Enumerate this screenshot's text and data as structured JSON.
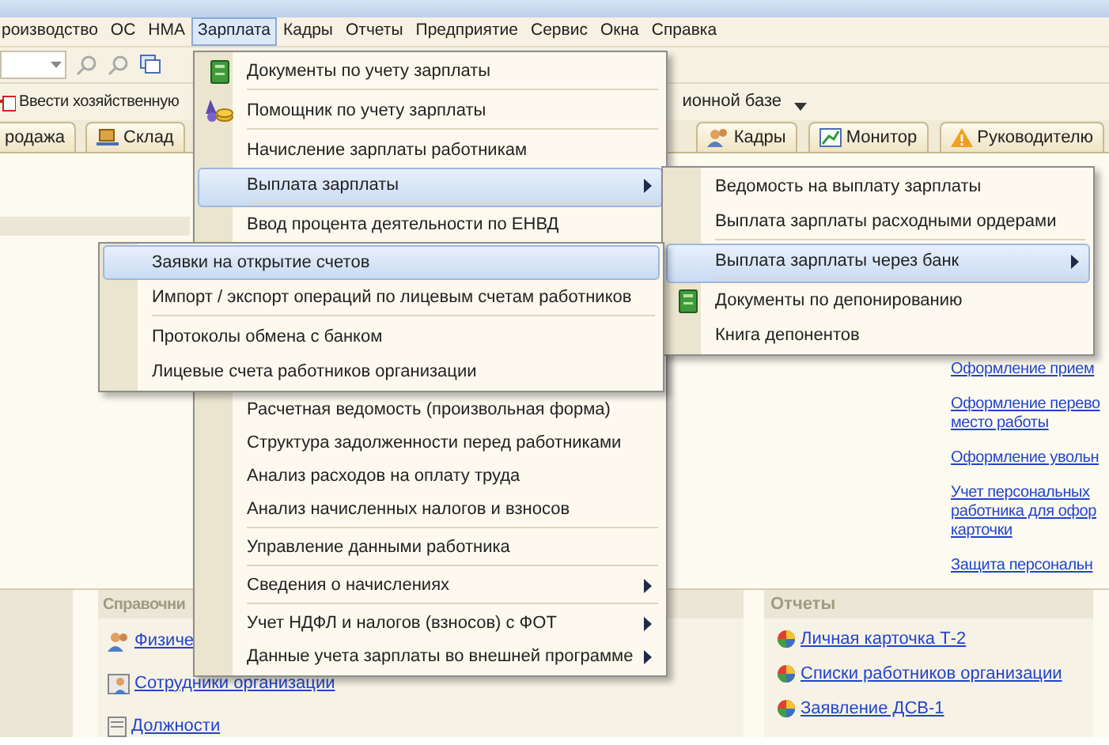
{
  "menubar": [
    {
      "label": "роизводство",
      "selected": false
    },
    {
      "label": "ОС",
      "selected": false
    },
    {
      "label": "НМА",
      "selected": false
    },
    {
      "label": "Зарплата",
      "selected": true
    },
    {
      "label": "Кадры",
      "selected": false
    },
    {
      "label": "Отчеты",
      "selected": false
    },
    {
      "label": "Предприятие",
      "selected": false
    },
    {
      "label": "Сервис",
      "selected": false
    },
    {
      "label": "Окна",
      "selected": false
    },
    {
      "label": "Справка",
      "selected": false
    }
  ],
  "toolbar": {
    "action": "Ввести хозяйственную",
    "action_tail": "ионной базе"
  },
  "tabs": [
    {
      "label": "родажа",
      "kind": "plain"
    },
    {
      "label": "Склад",
      "kind": "warehouse"
    },
    {
      "label": "Кадры",
      "kind": "staff"
    },
    {
      "label": "Монитор",
      "kind": "monitor"
    },
    {
      "label": "Руководителю",
      "kind": "warning"
    }
  ],
  "side_links": [
    {
      "lines": [
        "Оформление прием"
      ]
    },
    {
      "lines": [
        "Оформление перево",
        "место работы"
      ]
    },
    {
      "lines": [
        "Оформление увольн"
      ]
    },
    {
      "lines": [
        "Учет персональных",
        "работника для офор",
        "карточки"
      ]
    },
    {
      "lines": [
        "Защита персональн"
      ]
    }
  ],
  "catalogs": {
    "title": "Справочни",
    "links": [
      {
        "label": "Физиче",
        "kind": "people"
      },
      {
        "label": "Сотрудники организации",
        "kind": "person"
      },
      {
        "label": "Должности",
        "kind": "document"
      }
    ]
  },
  "reports": {
    "title": "Отчеты",
    "links": [
      "Личная карточка Т-2",
      "Списки работников организации",
      "Заявление ДСВ-1"
    ]
  },
  "menu": {
    "items": [
      {
        "label": "Документы по учету зарплаты",
        "kind": "doc",
        "submenu": false,
        "selected": false,
        "separator_after": true
      },
      {
        "label": "Помощник по учету зарплаты",
        "kind": "helper",
        "submenu": false,
        "selected": false,
        "separator_after": true
      },
      {
        "label": "Начисление зарплаты работникам",
        "kind": "plain",
        "submenu": false,
        "selected": false,
        "separator_after": false
      },
      {
        "label": "Выплата зарплаты",
        "kind": "plain",
        "submenu": true,
        "selected": true,
        "separator_after": true
      },
      {
        "label": "Ввод процента деятельности по ЕНВД",
        "kind": "plain",
        "submenu": false,
        "selected": false,
        "separator_after": false
      }
    ],
    "items_lower": [
      {
        "label": "Расчетная ведомость (произвольная форма)",
        "submenu": false,
        "selected": false,
        "separator_after": false
      },
      {
        "label": "Структура задолженности перед работниками",
        "submenu": false,
        "selected": false,
        "separator_after": false
      },
      {
        "label": "Анализ расходов на оплату труда",
        "submenu": false,
        "selected": false,
        "separator_after": false
      },
      {
        "label": "Анализ начисленных налогов и взносов",
        "submenu": false,
        "selected": false,
        "separator_after": true
      },
      {
        "label": "Управление данными работника",
        "submenu": false,
        "selected": false,
        "separator_after": true
      },
      {
        "label": "Сведения о начислениях",
        "submenu": true,
        "selected": false,
        "separator_after": true
      },
      {
        "label": "Учет НДФЛ и налогов (взносов) с ФОТ",
        "submenu": true,
        "selected": false,
        "separator_after": false
      },
      {
        "label": "Данные учета зарплаты во внешней программе",
        "submenu": true,
        "selected": false,
        "separator_after": false
      }
    ]
  },
  "submenu": {
    "items": [
      {
        "label": "Ведомость на выплату зарплаты",
        "kind": "plain",
        "submenu": false,
        "selected": false,
        "separator_after": false
      },
      {
        "label": "Выплата зарплаты расходными ордерами",
        "kind": "plain",
        "submenu": false,
        "selected": false,
        "separator_after": true
      },
      {
        "label": "Выплата зарплаты через банк",
        "kind": "plain",
        "submenu": true,
        "selected": true,
        "separator_after": true
      },
      {
        "label": "Документы по депонированию",
        "kind": "doc",
        "submenu": false,
        "selected": false,
        "separator_after": false
      },
      {
        "label": "Книга депонентов",
        "kind": "plain",
        "submenu": false,
        "selected": false,
        "separator_after": false
      }
    ]
  },
  "submenu_2": {
    "items": [
      {
        "label": "Заявки на открытие счетов",
        "submenu": false,
        "selected": true,
        "separator_after": false
      },
      {
        "label": "Импорт / экспорт операций по лицевым счетам работников",
        "submenu": false,
        "selected": false,
        "separator_after": true
      },
      {
        "label": "Протоколы обмена с банком",
        "submenu": false,
        "selected": false,
        "separator_after": false
      },
      {
        "label": "Лицевые счета работников организации",
        "submenu": false,
        "selected": false,
        "separator_after": false
      }
    ]
  }
}
